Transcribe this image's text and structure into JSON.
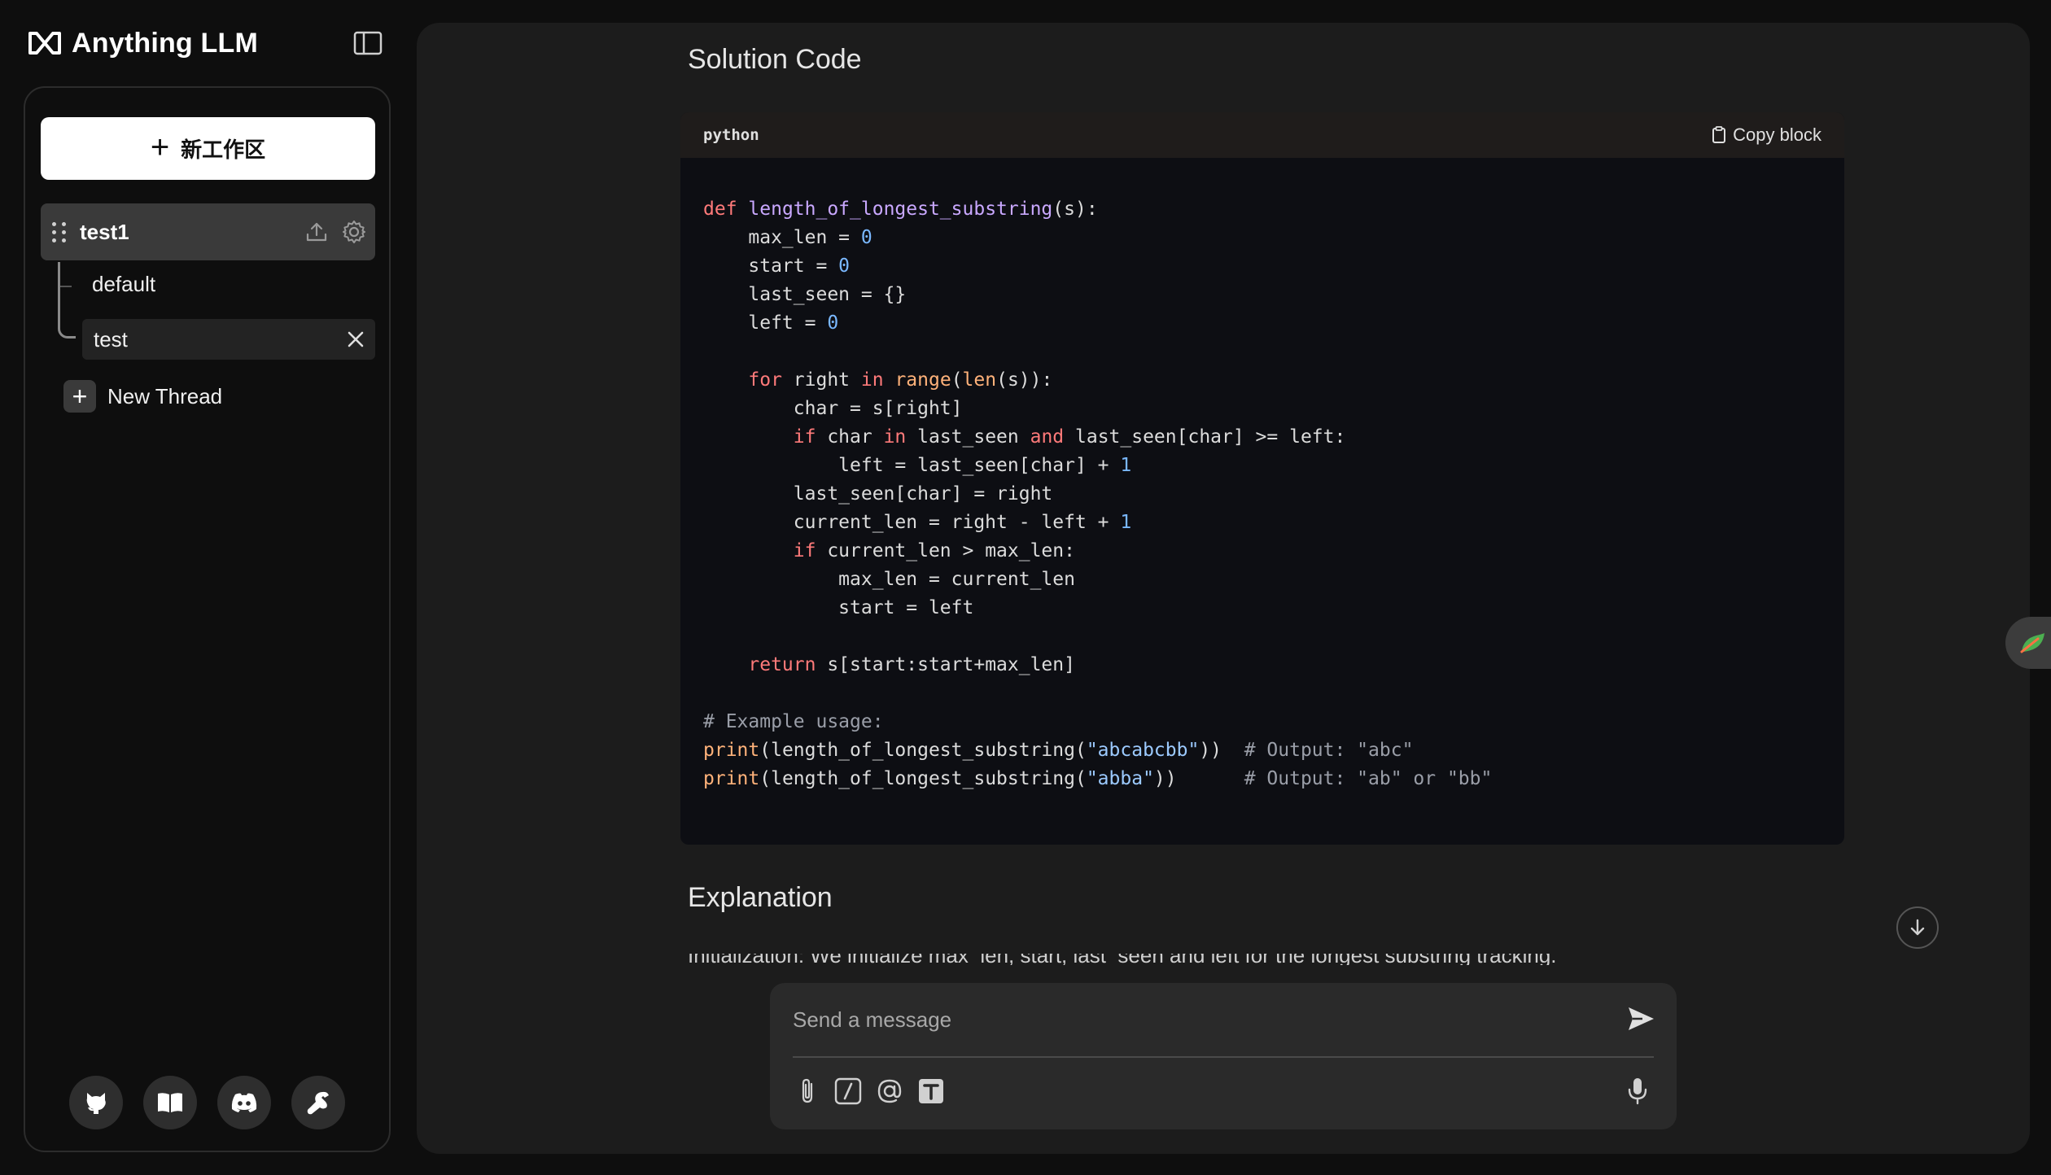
{
  "app": {
    "name": "Anything LLM"
  },
  "sidebar": {
    "new_workspace_label": "新工作区",
    "workspace": {
      "name": "test1",
      "threads": [
        {
          "label": "default",
          "active": false
        },
        {
          "label": "test",
          "active": true
        }
      ]
    },
    "new_thread_label": "New Thread",
    "footer_icons": [
      "github-icon",
      "docs-book-icon",
      "discord-icon",
      "settings-wrench-icon"
    ]
  },
  "chat": {
    "solution_heading": "Solution Code",
    "code_block": {
      "language": "python",
      "copy_label": "Copy block",
      "lines": [
        "def length_of_longest_substring(s):",
        "    max_len = 0",
        "    start = 0",
        "    last_seen = {}",
        "    left = 0",
        "",
        "    for right in range(len(s)):",
        "        char = s[right]",
        "        if char in last_seen and last_seen[char] >= left:",
        "            left = last_seen[char] + 1",
        "        last_seen[char] = right",
        "        current_len = right - left + 1",
        "        if current_len > max_len:",
        "            max_len = current_len",
        "            start = left",
        "",
        "    return s[start:start+max_len]",
        "",
        "# Example usage:",
        "print(length_of_longest_substring(\"abcabcbb\"))  # Output: \"abc\"",
        "print(length_of_longest_substring(\"abba\"))      # Output: \"ab\" or \"bb\""
      ]
    },
    "explanation_heading": "Explanation",
    "explanation_partial": "Initialization: We initialize max_len, start, last_seen and left for the longest substring tracking."
  },
  "composer": {
    "placeholder": "Send a message",
    "tool_icons": [
      "attachment-icon",
      "slash-command-icon",
      "at-mention-icon",
      "text-size-icon"
    ]
  },
  "colors": {
    "main_bg": "#1c1c1c",
    "sidebar_bg": "#0e0e0e",
    "code_bg": "#0d0e13",
    "keyword": "#ff7a7a",
    "function": "#c9a8ff",
    "number": "#7ab8ff",
    "comment": "#9a9ea8"
  }
}
